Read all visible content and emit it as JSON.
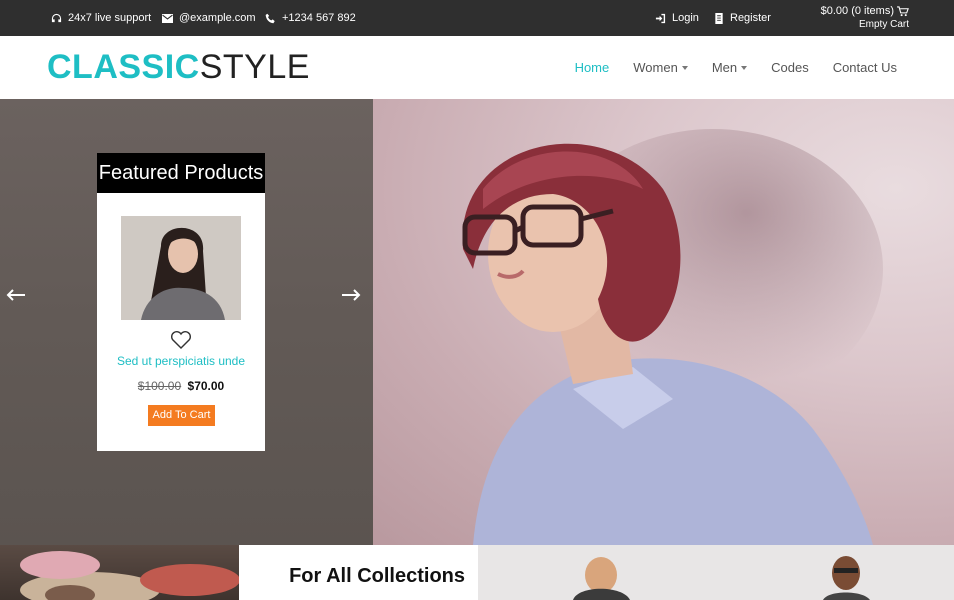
{
  "topbar": {
    "support": "24x7 live support",
    "email": "@example.com",
    "phone": "+1234 567 892",
    "login": "Login",
    "register": "Register",
    "cart_total": "$0.00 (0 items)",
    "cart_status": "Empty Cart"
  },
  "header": {
    "logo_part1": "CLASSIC",
    "logo_part2": "STYLE",
    "nav": {
      "home": "Home",
      "women": "Women",
      "men": "Men",
      "codes": "Codes",
      "contact": "Contact Us"
    }
  },
  "featured": {
    "title": "Featured Products",
    "product_name": "Sed ut perspiciatis unde",
    "old_price": "$100.00",
    "new_price": "$70.00",
    "add_to_cart": "Add To Cart"
  },
  "bottom": {
    "collections_title": "For All Collections"
  },
  "colors": {
    "accent": "#1ebec4",
    "button": "#f47b20",
    "topbar": "#2f2f2f"
  },
  "icons": [
    "headphones-icon",
    "envelope-icon",
    "phone-icon",
    "login-icon",
    "register-icon",
    "cart-icon",
    "heart-icon",
    "arrow-left-icon",
    "arrow-right-icon"
  ]
}
